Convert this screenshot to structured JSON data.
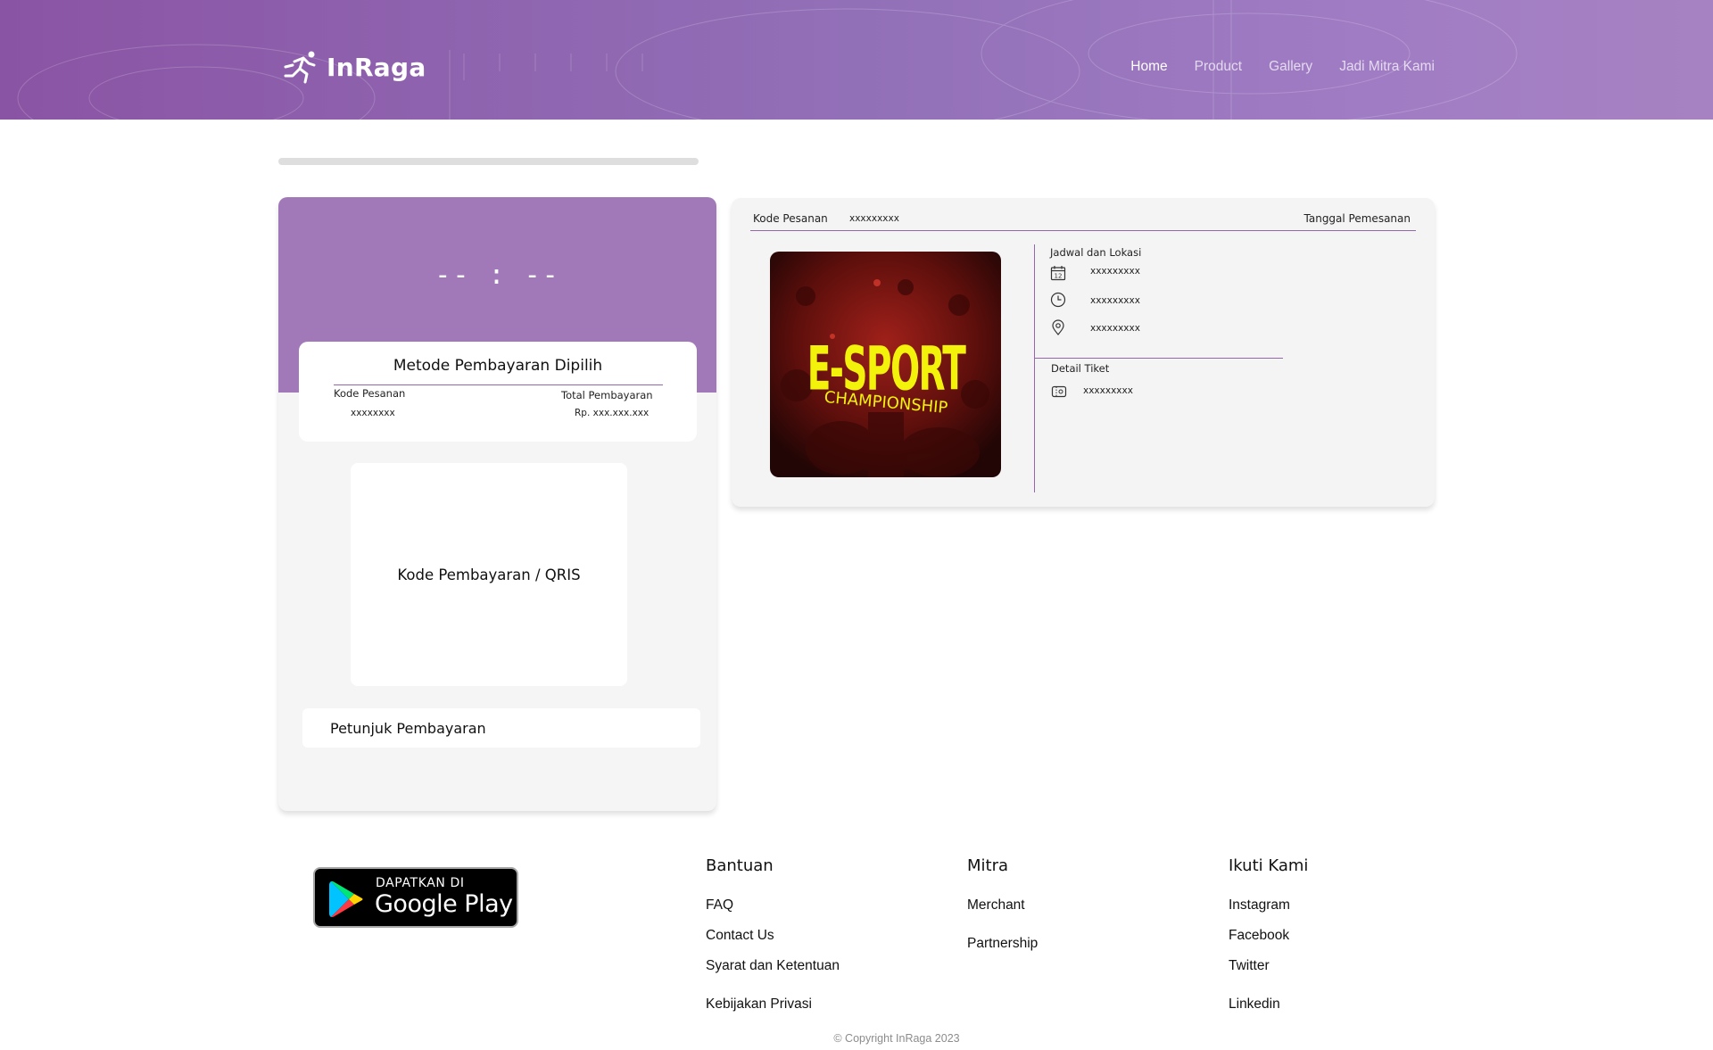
{
  "header": {
    "brand": "InRaga",
    "nav": [
      {
        "label": "Home",
        "active": true
      },
      {
        "label": "Product",
        "active": false
      },
      {
        "label": "Gallery",
        "active": false
      },
      {
        "label": "Jadi Mitra Kami",
        "active": false
      }
    ]
  },
  "payment": {
    "timer": "-- : --",
    "method_title": "Metode Pembayaran Dipilih",
    "order_code_label": "Kode Pesanan",
    "order_code_value": "xxxxxxxx",
    "total_label": "Total Pembayaran",
    "total_value": "Rp. xxx.xxx.xxx",
    "qris_label": "Kode Pembayaran / QRIS",
    "guide_label": "Petunjuk Pembayaran"
  },
  "order": {
    "order_code_label": "Kode Pesanan",
    "order_code_value": "xxxxxxxxx",
    "order_date_label": "Tanggal Pemesanan",
    "event_title_line1": "E-SPORT",
    "event_title_line2": "CHAMPIONSHIP",
    "schedule_title": "Jadwal dan Lokasi",
    "date_value": "xxxxxxxxx",
    "time_value": "xxxxxxxxx",
    "location_value": "xxxxxxxxx",
    "ticket_title": "Detail Tiket",
    "ticket_value": "xxxxxxxxx",
    "calendar_day": "12"
  },
  "footer": {
    "gplay_small": "DAPATKAN DI",
    "gplay_big": "Google Play",
    "bantuan": {
      "title": "Bantuan",
      "links": [
        "FAQ",
        "Contact Us",
        "Syarat dan Ketentuan",
        "Kebijakan Privasi"
      ]
    },
    "mitra": {
      "title": "Mitra",
      "links": [
        "Merchant",
        "Partnership"
      ]
    },
    "ikuti": {
      "title": "Ikuti Kami",
      "links": [
        "Instagram",
        "Facebook",
        "Twitter",
        "Linkedin"
      ]
    },
    "copyright": "© Copyright InRaga 2023"
  },
  "colors": {
    "brand_purple": "#a279b8",
    "accent_line": "#9467ad",
    "event_text": "#f2f20a"
  }
}
